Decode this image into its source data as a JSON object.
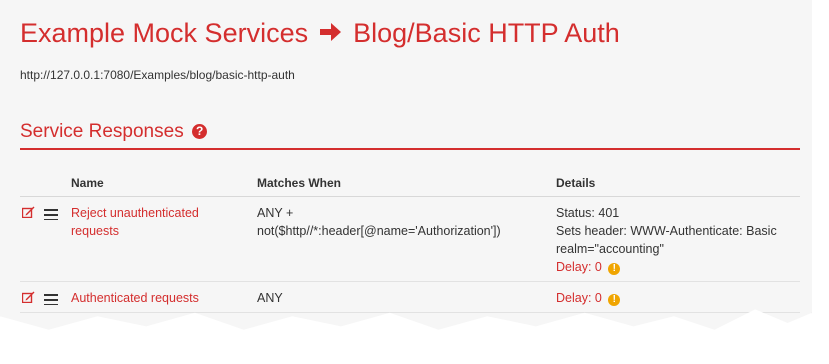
{
  "header": {
    "title_prefix": "Example Mock Services",
    "title_suffix": "Blog/Basic HTTP Auth",
    "url": "http://127.0.0.1:7080/Examples/blog/basic-http-auth"
  },
  "section": {
    "title": "Service Responses",
    "help_icon": "question-circle-icon"
  },
  "table": {
    "columns": [
      "Name",
      "Matches When",
      "Details"
    ],
    "rows": [
      {
        "name_line1": "Reject unauthenticated",
        "name_line2": "requests",
        "match_line1": "ANY +",
        "match_line2": "not($http//*:header[@name='Authorization'])",
        "details_status": "Status: 401",
        "details_header_line1": "Sets header: WWW-Authenticate: Basic",
        "details_header_line2": "realm=\"accounting\"",
        "delay": "Delay: 0"
      },
      {
        "name_line1": "Authenticated requests",
        "match_line1": "ANY",
        "delay": "Delay: 0"
      }
    ]
  },
  "colors": {
    "accent": "#d42e2e",
    "warning": "#f0a500"
  }
}
